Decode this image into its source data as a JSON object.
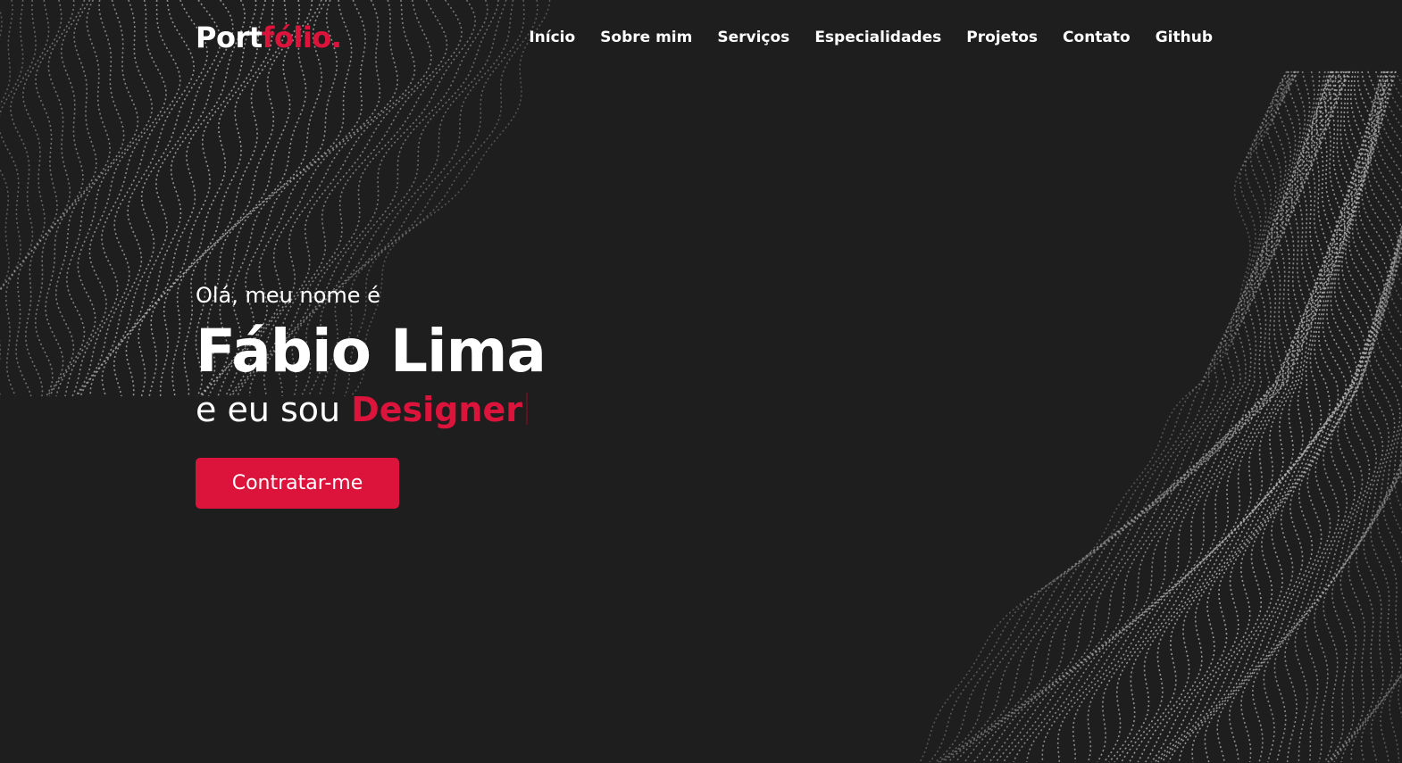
{
  "nav": {
    "logo_main": "Port",
    "logo_accent": "fólio.",
    "items": [
      {
        "label": "Início"
      },
      {
        "label": "Sobre mim"
      },
      {
        "label": "Serviços"
      },
      {
        "label": "Especialidades"
      },
      {
        "label": "Projetos"
      },
      {
        "label": "Contato"
      },
      {
        "label": "Github"
      }
    ]
  },
  "hero": {
    "greeting": "Olá, meu nome é",
    "name": "Fábio Lima",
    "role_prefix": "e eu sou",
    "role_typed": "Designer",
    "cta_label": "Contratar-me"
  },
  "colors": {
    "background": "#1e1e1e",
    "accent": "#dc143c",
    "text": "#ffffff",
    "dots": "#b4b4b4"
  }
}
